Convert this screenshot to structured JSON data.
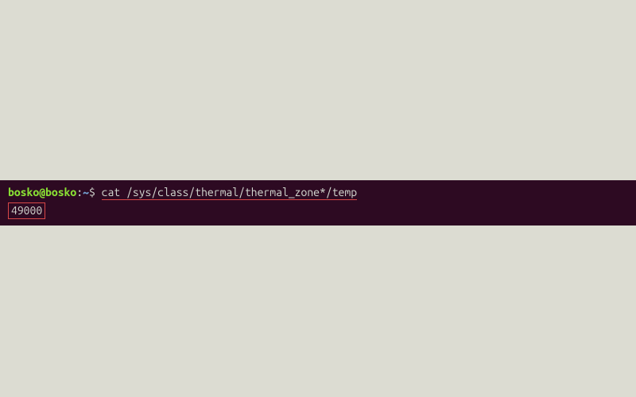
{
  "terminal": {
    "prompt": {
      "user_host": "bosko@bosko",
      "colon": ":",
      "path": "~",
      "symbol": "$"
    },
    "command": "cat /sys/class/thermal/thermal_zone*/temp",
    "output": "49000"
  }
}
